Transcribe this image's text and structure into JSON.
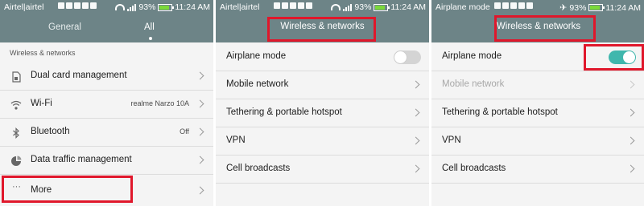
{
  "panel1": {
    "status": {
      "carrier": "Airtel|airtel",
      "battery": "93%",
      "time": "11:24 AM"
    },
    "tabs": [
      {
        "label": "General"
      },
      {
        "label": "All"
      }
    ],
    "section": "Wireless & networks",
    "items": [
      {
        "label": "Dual card management",
        "value": "",
        "icon": "sim-card-icon"
      },
      {
        "label": "Wi-Fi",
        "value": "realme Narzo 10A",
        "icon": "wifi-icon"
      },
      {
        "label": "Bluetooth",
        "value": "Off",
        "icon": "bluetooth-icon"
      },
      {
        "label": "Data traffic management",
        "value": "",
        "icon": "data-traffic-icon"
      },
      {
        "label": "More",
        "value": "",
        "icon": "more-dots-icon"
      }
    ]
  },
  "panel2": {
    "status": {
      "carrier": "Airtel|airtel",
      "battery": "93%",
      "time": "11:24 AM"
    },
    "title": "Wireless & networks",
    "items": [
      {
        "label": "Airplane mode",
        "toggle": "off"
      },
      {
        "label": "Mobile network"
      },
      {
        "label": "Tethering & portable hotspot"
      },
      {
        "label": "VPN"
      },
      {
        "label": "Cell broadcasts"
      }
    ]
  },
  "panel3": {
    "status": {
      "carrier": "Airplane mode",
      "battery": "93%",
      "time": "11:24 AM"
    },
    "title": "Wireless & networks",
    "items": [
      {
        "label": "Airplane mode",
        "toggle": "on"
      },
      {
        "label": "Mobile network",
        "disabled": true
      },
      {
        "label": "Tethering & portable hotspot"
      },
      {
        "label": "VPN"
      },
      {
        "label": "Cell broadcasts"
      }
    ]
  },
  "colors": {
    "header": "#6d8487",
    "highlight": "#e0172b",
    "toggle_on": "#3fb7ad",
    "battery": "#7bd93b"
  }
}
